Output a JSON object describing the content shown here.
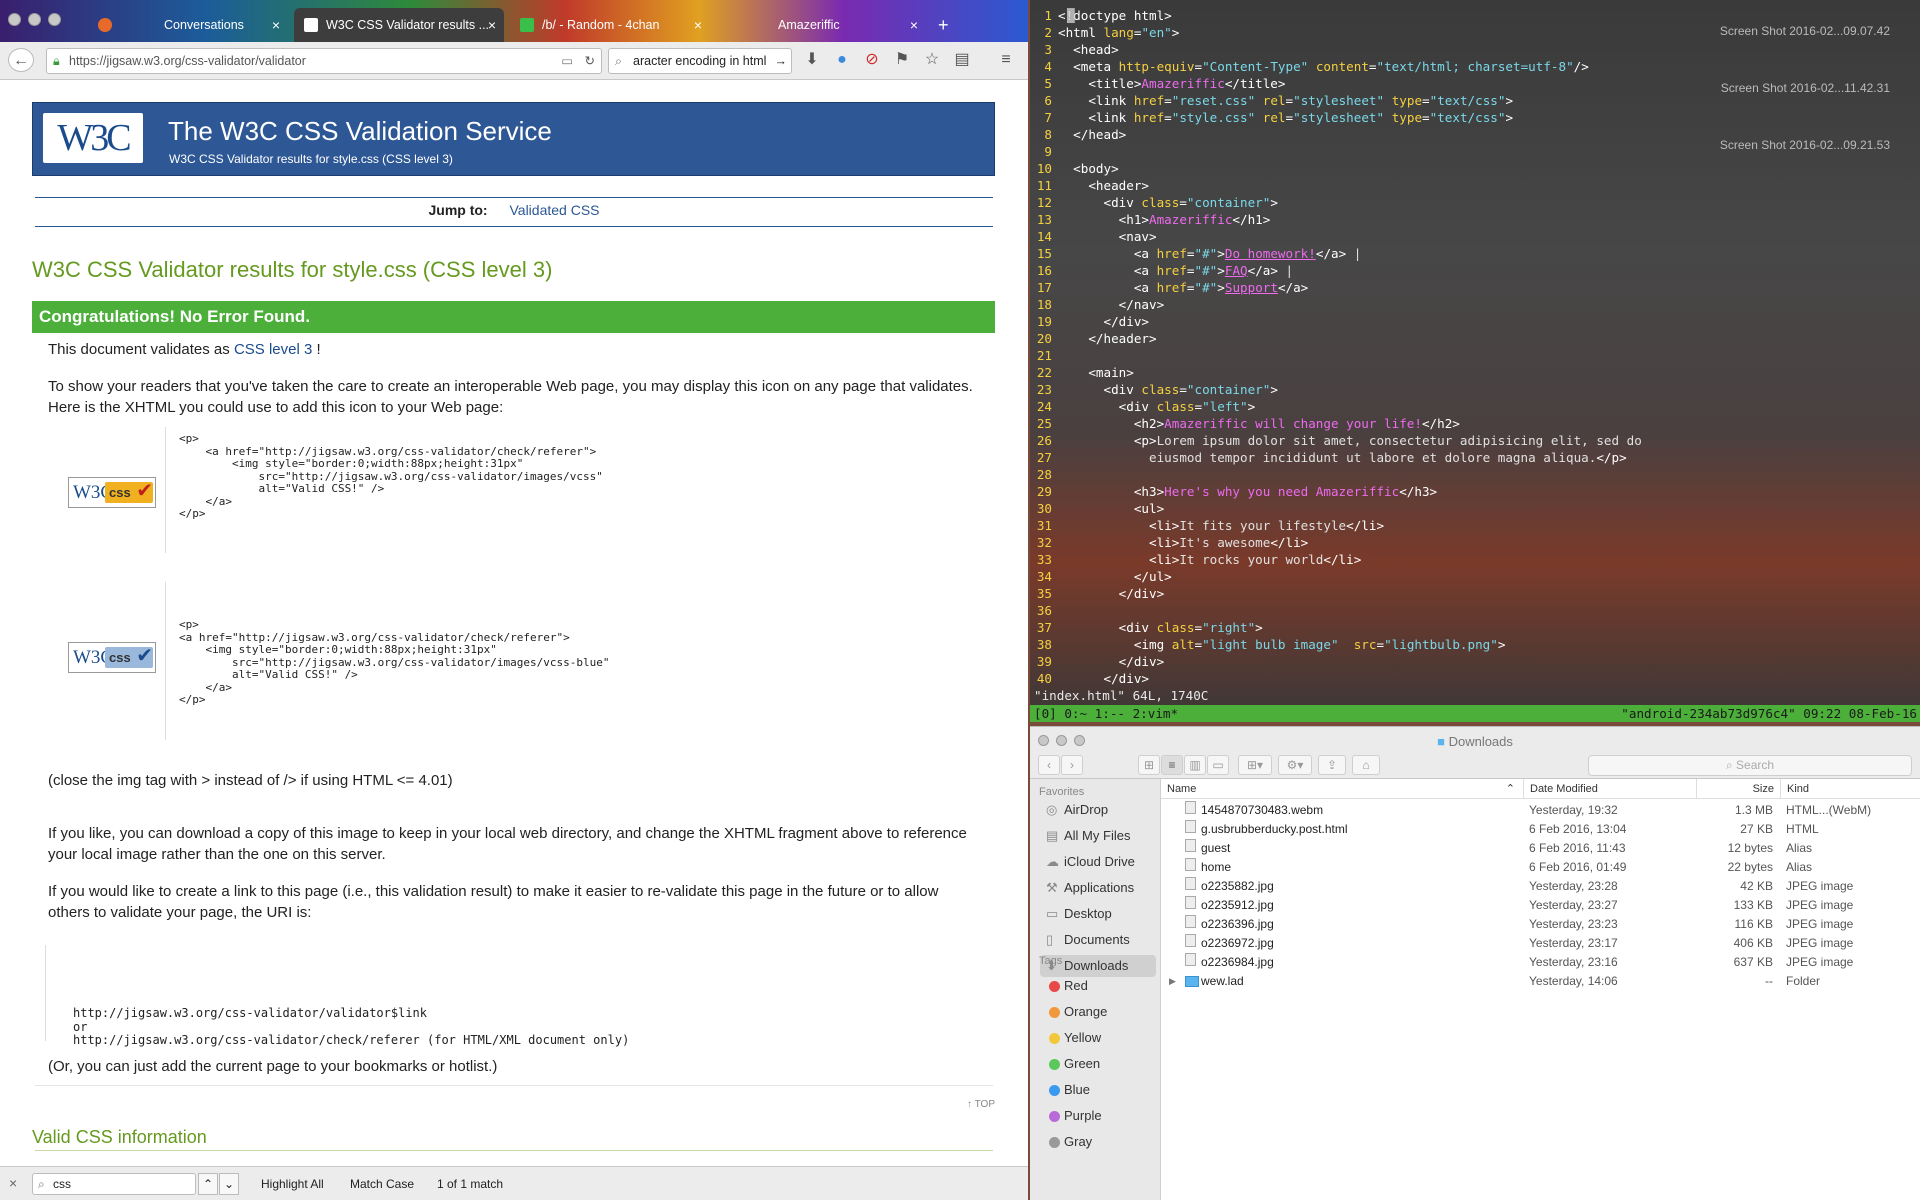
{
  "browser": {
    "tabs": [
      {
        "label": "Conversations"
      },
      {
        "label": "W3C CSS Validator results ..."
      },
      {
        "label": "/b/ - Random - 4chan"
      },
      {
        "label": "Amazeriffic"
      }
    ],
    "new_tab": "+",
    "url": "https://jigsaw.w3.org/css-validator/validator",
    "search_value": "aracter encoding in html"
  },
  "page": {
    "banner_title": "The W3C CSS Validation Service",
    "banner_subtitle": "W3C CSS Validator results for style.css (CSS level 3)",
    "logo_text": "W3C",
    "jump_label": "Jump to:",
    "jump_link": "Validated CSS",
    "results_title": "W3C CSS Validator results for style.css (CSS level 3)",
    "congrats": "Congratulations! No Error Found.",
    "validates_prefix": "This document validates as",
    "validates_link": "CSS level 3",
    "validates_suffix": "!",
    "show_readers": "To show your readers that you've taken the care to create an interoperable Web page, you may display this icon on any page that validates. Here is the XHTML you could use to add this icon to your Web page:",
    "code1": "<p>\n    <a href=\"http://jigsaw.w3.org/css-validator/check/referer\">\n        <img style=\"border:0;width:88px;height:31px\"\n            src=\"http://jigsaw.w3.org/css-validator/images/vcss\"\n            alt=\"Valid CSS!\" />\n    </a>\n</p>",
    "code2": "<p>\n<a href=\"http://jigsaw.w3.org/css-validator/check/referer\">\n    <img style=\"border:0;width:88px;height:31px\"\n        src=\"http://jigsaw.w3.org/css-validator/images/vcss-blue\"\n        alt=\"Valid CSS!\" />\n    </a>\n</p>",
    "badge_text": "css",
    "close_img": "(close the img tag with > instead of /> if using HTML <= 4.01)",
    "download_copy": "If you like, you can download a copy of this image to keep in your local web directory, and change the XHTML fragment above to reference your local image rather than the one on this server.",
    "create_link": "If you would like to create a link to this page (i.e., this validation result) to make it easier to re-validate this page in the future or to allow others to validate your page, the URI is:",
    "uri_block": "http://jigsaw.w3.org/css-validator/validator$link\nor\nhttp://jigsaw.w3.org/css-validator/check/referer (for HTML/XML document only)",
    "bookmarks": "(Or, you can just add the current page to your bookmarks or hotlist.)",
    "top_link": "↑ TOP",
    "valid_css_info": "Valid CSS information"
  },
  "findbar": {
    "query": "css",
    "highlight_all": "Highlight All",
    "match_case": "Match Case",
    "result": "1 of 1 match"
  },
  "terminal": {
    "desktop_labels": [
      "Screen Shot\n2016-02...09.07.42",
      "Screen Shot\n2016-02...11.42.31",
      "Screen Shot\n2016-02...09.21.53"
    ],
    "lines": [
      [
        {
          "c": "tg",
          "t": "<!doctype html>"
        }
      ],
      [
        {
          "c": "tg",
          "t": "<html "
        },
        {
          "c": "at",
          "t": "lang"
        },
        {
          "c": "tg",
          "t": "="
        },
        {
          "c": "st",
          "t": "\"en\""
        },
        {
          "c": "tg",
          "t": ">"
        }
      ],
      [
        {
          "c": "tg",
          "t": "  <head>"
        }
      ],
      [
        {
          "c": "tg",
          "t": "  <meta "
        },
        {
          "c": "at",
          "t": "http-equiv"
        },
        {
          "c": "tg",
          "t": "="
        },
        {
          "c": "st",
          "t": "\"Content-Type\""
        },
        {
          "c": "at",
          "t": " content"
        },
        {
          "c": "tg",
          "t": "="
        },
        {
          "c": "st",
          "t": "\"text/html; charset=utf-8\""
        },
        {
          "c": "tg",
          "t": "/>"
        }
      ],
      [
        {
          "c": "tg",
          "t": "    <title>"
        },
        {
          "c": "nm",
          "t": "Amazeriffic"
        },
        {
          "c": "tg",
          "t": "</title>"
        }
      ],
      [
        {
          "c": "tg",
          "t": "    <link "
        },
        {
          "c": "at",
          "t": "href"
        },
        {
          "c": "tg",
          "t": "="
        },
        {
          "c": "st",
          "t": "\"reset.css\""
        },
        {
          "c": "at",
          "t": " rel"
        },
        {
          "c": "tg",
          "t": "="
        },
        {
          "c": "st",
          "t": "\"stylesheet\""
        },
        {
          "c": "at",
          "t": " type"
        },
        {
          "c": "tg",
          "t": "="
        },
        {
          "c": "st",
          "t": "\"text/css\""
        },
        {
          "c": "tg",
          "t": ">"
        }
      ],
      [
        {
          "c": "tg",
          "t": "    <link "
        },
        {
          "c": "at",
          "t": "href"
        },
        {
          "c": "tg",
          "t": "="
        },
        {
          "c": "st",
          "t": "\"style.css\""
        },
        {
          "c": "at",
          "t": " rel"
        },
        {
          "c": "tg",
          "t": "="
        },
        {
          "c": "st",
          "t": "\"stylesheet\""
        },
        {
          "c": "at",
          "t": " type"
        },
        {
          "c": "tg",
          "t": "="
        },
        {
          "c": "st",
          "t": "\"text/css\""
        },
        {
          "c": "tg",
          "t": ">"
        }
      ],
      [
        {
          "c": "tg",
          "t": "  </head>"
        }
      ],
      [
        {
          "c": "tx",
          "t": ""
        }
      ],
      [
        {
          "c": "tg",
          "t": "  <body>"
        }
      ],
      [
        {
          "c": "tg",
          "t": "    <header>"
        }
      ],
      [
        {
          "c": "tg",
          "t": "      <div "
        },
        {
          "c": "at",
          "t": "class"
        },
        {
          "c": "tg",
          "t": "="
        },
        {
          "c": "st",
          "t": "\"container\""
        },
        {
          "c": "tg",
          "t": ">"
        }
      ],
      [
        {
          "c": "tg",
          "t": "        <h1>"
        },
        {
          "c": "nm",
          "t": "Amazeriffic"
        },
        {
          "c": "tg",
          "t": "</h1>"
        }
      ],
      [
        {
          "c": "tg",
          "t": "        <nav>"
        }
      ],
      [
        {
          "c": "tg",
          "t": "          <a "
        },
        {
          "c": "at",
          "t": "href"
        },
        {
          "c": "tg",
          "t": "="
        },
        {
          "c": "st",
          "t": "\"#\""
        },
        {
          "c": "tg",
          "t": ">"
        },
        {
          "c": "hl",
          "t": "Do homework!"
        },
        {
          "c": "tg",
          "t": "</a>"
        },
        {
          "c": "tx",
          "t": " |"
        }
      ],
      [
        {
          "c": "tg",
          "t": "          <a "
        },
        {
          "c": "at",
          "t": "href"
        },
        {
          "c": "tg",
          "t": "="
        },
        {
          "c": "st",
          "t": "\"#\""
        },
        {
          "c": "tg",
          "t": ">"
        },
        {
          "c": "hl",
          "t": "FAQ"
        },
        {
          "c": "tg",
          "t": "</a>"
        },
        {
          "c": "tx",
          "t": " |"
        }
      ],
      [
        {
          "c": "tg",
          "t": "          <a "
        },
        {
          "c": "at",
          "t": "href"
        },
        {
          "c": "tg",
          "t": "="
        },
        {
          "c": "st",
          "t": "\"#\""
        },
        {
          "c": "tg",
          "t": ">"
        },
        {
          "c": "hl",
          "t": "Support"
        },
        {
          "c": "tg",
          "t": "</a>"
        }
      ],
      [
        {
          "c": "tg",
          "t": "        </nav>"
        }
      ],
      [
        {
          "c": "tg",
          "t": "      </div>"
        }
      ],
      [
        {
          "c": "tg",
          "t": "    </header>"
        }
      ],
      [
        {
          "c": "tx",
          "t": ""
        }
      ],
      [
        {
          "c": "tg",
          "t": "    <main>"
        }
      ],
      [
        {
          "c": "tg",
          "t": "      <div "
        },
        {
          "c": "at",
          "t": "class"
        },
        {
          "c": "tg",
          "t": "="
        },
        {
          "c": "st",
          "t": "\"container\""
        },
        {
          "c": "tg",
          "t": ">"
        }
      ],
      [
        {
          "c": "tg",
          "t": "        <div "
        },
        {
          "c": "at",
          "t": "class"
        },
        {
          "c": "tg",
          "t": "="
        },
        {
          "c": "st",
          "t": "\"left\""
        },
        {
          "c": "tg",
          "t": ">"
        }
      ],
      [
        {
          "c": "tg",
          "t": "          <h2>"
        },
        {
          "c": "nm",
          "t": "Amazeriffic will change your life!"
        },
        {
          "c": "tg",
          "t": "</h2>"
        }
      ],
      [
        {
          "c": "tg",
          "t": "          <p>"
        },
        {
          "c": "tx",
          "t": "Lorem ipsum dolor sit amet, consectetur adipisicing elit, sed do"
        }
      ],
      [
        {
          "c": "tx",
          "t": "            eiusmod tempor incididunt ut labore et dolore magna aliqua."
        },
        {
          "c": "tg",
          "t": "</p>"
        }
      ],
      [
        {
          "c": "tx",
          "t": ""
        }
      ],
      [
        {
          "c": "tg",
          "t": "          <h3>"
        },
        {
          "c": "nm",
          "t": "Here's why you need Amazeriffic"
        },
        {
          "c": "tg",
          "t": "</h3>"
        }
      ],
      [
        {
          "c": "tg",
          "t": "          <ul>"
        }
      ],
      [
        {
          "c": "tg",
          "t": "            <li>"
        },
        {
          "c": "tx",
          "t": "It fits your lifestyle"
        },
        {
          "c": "tg",
          "t": "</li>"
        }
      ],
      [
        {
          "c": "tg",
          "t": "            <li>"
        },
        {
          "c": "tx",
          "t": "It's awesome"
        },
        {
          "c": "tg",
          "t": "</li>"
        }
      ],
      [
        {
          "c": "tg",
          "t": "            <li>"
        },
        {
          "c": "tx",
          "t": "It rocks your world"
        },
        {
          "c": "tg",
          "t": "</li>"
        }
      ],
      [
        {
          "c": "tg",
          "t": "          </ul>"
        }
      ],
      [
        {
          "c": "tg",
          "t": "        </div>"
        }
      ],
      [
        {
          "c": "tx",
          "t": ""
        }
      ],
      [
        {
          "c": "tg",
          "t": "        <div "
        },
        {
          "c": "at",
          "t": "class"
        },
        {
          "c": "tg",
          "t": "="
        },
        {
          "c": "st",
          "t": "\"right\""
        },
        {
          "c": "tg",
          "t": ">"
        }
      ],
      [
        {
          "c": "tg",
          "t": "          <img "
        },
        {
          "c": "at",
          "t": "alt"
        },
        {
          "c": "tg",
          "t": "="
        },
        {
          "c": "st",
          "t": "\"light bulb image\""
        },
        {
          "c": "at",
          "t": "  src"
        },
        {
          "c": "tg",
          "t": "="
        },
        {
          "c": "st",
          "t": "\"lightbulb.png\""
        },
        {
          "c": "tg",
          "t": ">"
        }
      ],
      [
        {
          "c": "tg",
          "t": "        </div>"
        }
      ],
      [
        {
          "c": "tg",
          "t": "      </div>"
        }
      ]
    ],
    "vim_status": "\"index.html\" 64L, 1740C",
    "tmux_left": "[0] 0:~  1:-- 2:vim*",
    "tmux_right": "\"android-234ab73d976c4\" 09:22 08-Feb-16"
  },
  "finder": {
    "title": "Downloads",
    "search_placeholder": "Search",
    "favorites_label": "Favorites",
    "favorites": [
      {
        "label": "AirDrop",
        "icon": "airdrop-icon",
        "glyph": "◎"
      },
      {
        "label": "All My Files",
        "icon": "all-files-icon",
        "glyph": "▤"
      },
      {
        "label": "iCloud Drive",
        "icon": "cloud-icon",
        "glyph": "☁"
      },
      {
        "label": "Applications",
        "icon": "applications-icon",
        "glyph": "⚒"
      },
      {
        "label": "Desktop",
        "icon": "desktop-icon",
        "glyph": "▭"
      },
      {
        "label": "Documents",
        "icon": "documents-icon",
        "glyph": "▯"
      },
      {
        "label": "Downloads",
        "icon": "downloads-icon",
        "glyph": "⬇",
        "selected": true
      }
    ],
    "tags_label": "Tags",
    "tags": [
      {
        "label": "Red",
        "color": "#e94848"
      },
      {
        "label": "Orange",
        "color": "#f0983a"
      },
      {
        "label": "Yellow",
        "color": "#f2c83a"
      },
      {
        "label": "Green",
        "color": "#5ac85a"
      },
      {
        "label": "Blue",
        "color": "#3a9af0"
      },
      {
        "label": "Purple",
        "color": "#b86ad8"
      },
      {
        "label": "Gray",
        "color": "#999999"
      }
    ],
    "columns": {
      "name": "Name",
      "date": "Date Modified",
      "size": "Size",
      "kind": "Kind"
    },
    "files": [
      {
        "name": "1454870730483.webm",
        "date": "Yesterday, 19:32",
        "size": "1.3 MB",
        "kind": "HTML...(WebM)",
        "folder": false
      },
      {
        "name": "g.usbrubberducky.post.html",
        "date": "6 Feb 2016, 13:04",
        "size": "27 KB",
        "kind": "HTML",
        "folder": false
      },
      {
        "name": "guest",
        "date": "6 Feb 2016, 11:43",
        "size": "12 bytes",
        "kind": "Alias",
        "folder": false
      },
      {
        "name": "home",
        "date": "6 Feb 2016, 01:49",
        "size": "22 bytes",
        "kind": "Alias",
        "folder": false
      },
      {
        "name": "o2235882.jpg",
        "date": "Yesterday, 23:28",
        "size": "42 KB",
        "kind": "JPEG image",
        "folder": false
      },
      {
        "name": "o2235912.jpg",
        "date": "Yesterday, 23:27",
        "size": "133 KB",
        "kind": "JPEG image",
        "folder": false
      },
      {
        "name": "o2236396.jpg",
        "date": "Yesterday, 23:23",
        "size": "116 KB",
        "kind": "JPEG image",
        "folder": false
      },
      {
        "name": "o2236972.jpg",
        "date": "Yesterday, 23:17",
        "size": "406 KB",
        "kind": "JPEG image",
        "folder": false
      },
      {
        "name": "o2236984.jpg",
        "date": "Yesterday, 23:16",
        "size": "637 KB",
        "kind": "JPEG image",
        "folder": false
      },
      {
        "name": "wew.lad",
        "date": "Yesterday, 14:06",
        "size": "--",
        "kind": "Folder",
        "folder": true
      }
    ]
  }
}
